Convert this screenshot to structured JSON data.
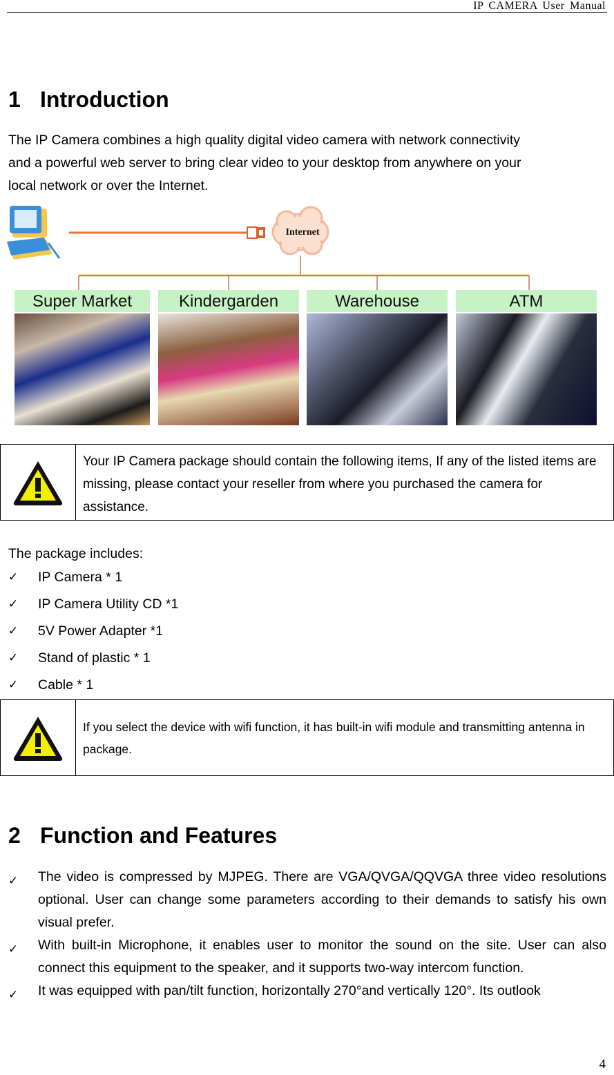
{
  "header": {
    "title": "IP  CAMERA  User  Manual"
  },
  "section1": {
    "number": "1",
    "title": "Introduction",
    "intro_lines": [
      "The IP Camera combines a high quality digital video camera with network connectivity",
      "and a powerful web server to bring clear video to your desktop from anywhere on your",
      "local network or over the Internet."
    ]
  },
  "diagram": {
    "cloud_label": "Internet",
    "icons": [
      "computer-icon",
      "network-connector-icon",
      "internet-cloud-icon"
    ],
    "colors": {
      "line": "#f07030",
      "label_bg": "#c6f2c6",
      "cloud": "#fbe0cf"
    },
    "panels": [
      {
        "label": "Super Market"
      },
      {
        "label": "Kindergarden"
      },
      {
        "label": "Warehouse"
      },
      {
        "label": "ATM"
      }
    ]
  },
  "notice1": {
    "icon": "warning-icon",
    "text": "Your IP Camera package should contain the following items, If any of the listed items are missing, please contact your reseller from where you purchased the camera for assistance."
  },
  "package": {
    "heading": "The package includes:",
    "items": [
      "IP Camera * 1",
      "IP Camera Utility CD *1",
      "5V Power Adapter *1",
      "Stand of plastic * 1",
      "Cable * 1"
    ]
  },
  "notice2": {
    "icon": "warning-icon",
    "text": "If you select the device with wifi function, it has built-in wifi module and transmitting antenna in package."
  },
  "section2": {
    "number": "2",
    "title": "Function and Features",
    "items": [
      "The video is compressed by MJPEG. There are VGA/QVGA/QQVGA three video resolutions optional. User can change some parameters according to their demands to satisfy his own visual prefer.",
      "With built-in Microphone, it enables user to monitor the sound on the site. User can also connect this equipment to the speaker, and it supports two-way intercom function.",
      "It was equipped with pan/tilt function, horizontally 270°and vertically 120°. Its outlook"
    ]
  },
  "check_glyph": "✓",
  "page_number": "4"
}
